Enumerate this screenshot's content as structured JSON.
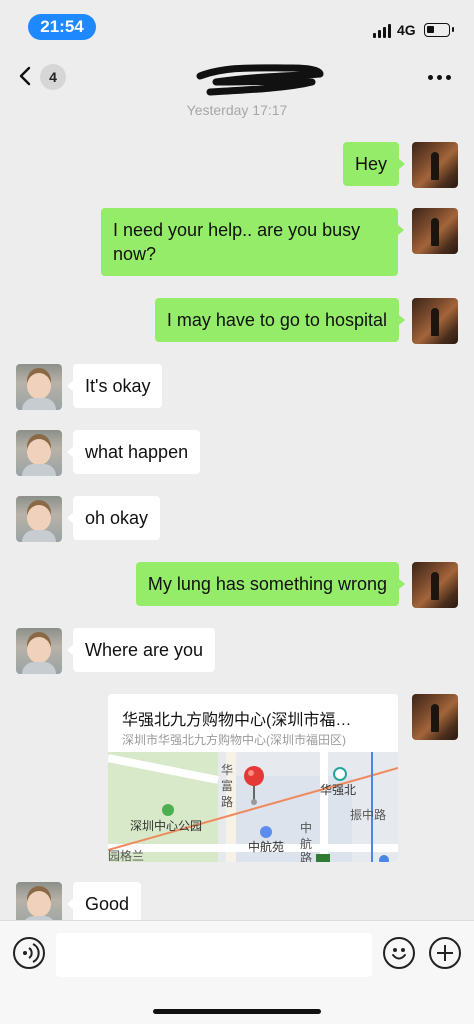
{
  "status_bar": {
    "time": "21:54",
    "network": "4G"
  },
  "nav": {
    "unread_count": "4",
    "more_label": "More"
  },
  "timestamp": "Yesterday 17:17",
  "messages": [
    {
      "from": "me",
      "text": "Hey"
    },
    {
      "from": "me",
      "text": "I need your help.. are you busy now?"
    },
    {
      "from": "me",
      "text": "I may have to go to hospital"
    },
    {
      "from": "them",
      "text": "It's okay"
    },
    {
      "from": "them",
      "text": "what happen"
    },
    {
      "from": "them",
      "text": "oh okay"
    },
    {
      "from": "me",
      "text": "My lung has something wrong"
    },
    {
      "from": "them",
      "text": "Where are you"
    },
    {
      "from": "them",
      "text": "Good"
    }
  ],
  "location": {
    "title": "华强北九方购物中心(深圳市福…",
    "address": "深圳市华强北九方购物中心(深圳市福田区)",
    "map_labels": {
      "road_hua": "华",
      "road_fu": "富",
      "road_lu": "路",
      "huaqiangbei": "华强北",
      "zhenzhong": "振中路",
      "park": "深圳中心公园",
      "zhonghangyuan": "中航苑",
      "zhong": "中",
      "hang": "航",
      "lu2": "路",
      "yuangelan": "园格兰"
    }
  },
  "input": {
    "placeholder": ""
  },
  "colors": {
    "my_bubble": "#95ec69",
    "their_bubble": "#ffffff",
    "background": "#ededed",
    "time_pill": "#1e88ff",
    "map_pin": "#e53935"
  },
  "icons": {
    "back": "chevron-left-icon",
    "more": "more-dots-icon",
    "voice": "voice-icon",
    "emoji": "emoji-icon",
    "plus": "plus-icon"
  }
}
